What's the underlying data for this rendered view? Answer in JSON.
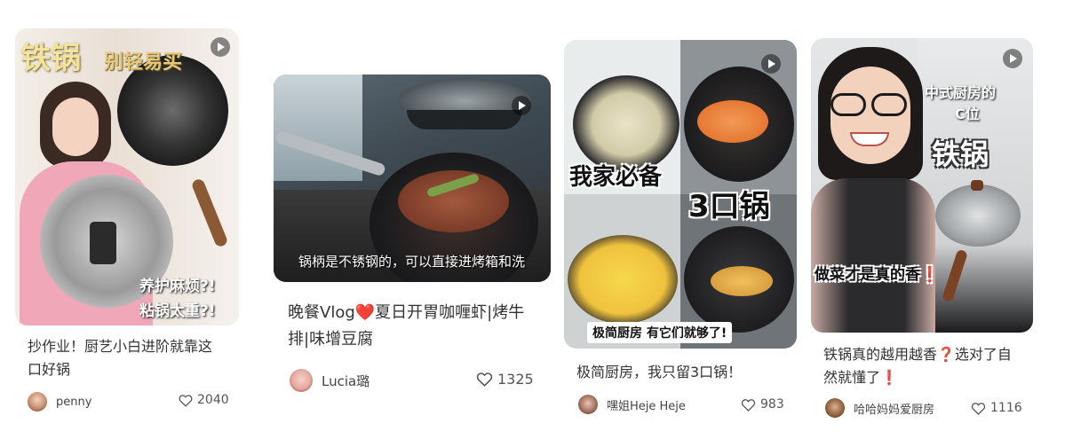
{
  "cards": [
    {
      "title": "抄作业！厨艺小白进阶就靠这口好锅",
      "author": "penny",
      "likes": "2040",
      "overlays": [
        "铁锅",
        "别轻易买",
        "养护麻烦?!",
        "粘锅太重?!"
      ]
    },
    {
      "title": "晚餐Vlog❤️夏日开胃咖喱虾|烤牛排|味增豆腐",
      "author": "Lucia璐",
      "likes": "1325",
      "overlays": [
        "锅柄是不锈钢的，可以直接进烤箱和洗"
      ]
    },
    {
      "title": "极简厨房，我只留3口锅！",
      "author": "嘿姐Heje Heje",
      "likes": "983",
      "overlays": [
        "我家必备",
        "3口锅",
        "极简厨房  有它们就够了!"
      ]
    },
    {
      "title": "铁锅真的越用越香❓选对了自然就懂了❗",
      "author": "哈哈妈妈爱厨房",
      "likes": "1116",
      "overlays": [
        "中式厨房的",
        "C位",
        "铁锅",
        "做菜才是真的香❗"
      ]
    }
  ],
  "icons": {
    "like": "heart-outline-icon",
    "video": "play-icon"
  }
}
